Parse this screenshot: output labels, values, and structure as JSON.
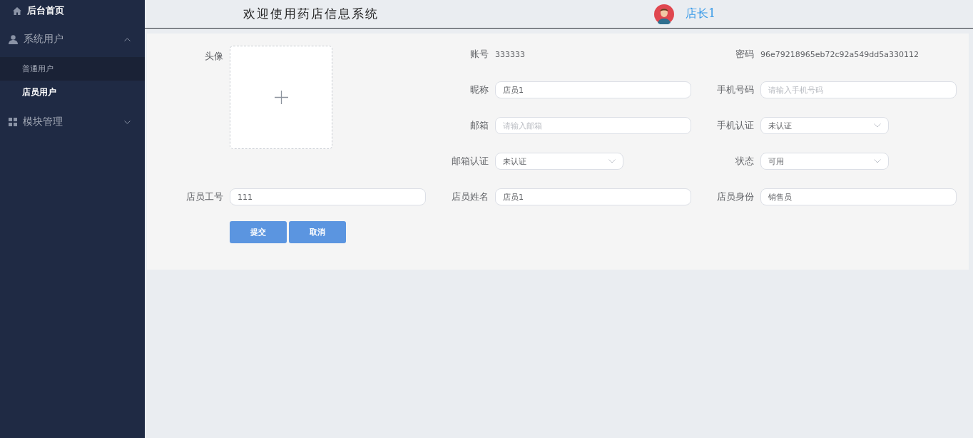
{
  "sidebar": {
    "items": [
      {
        "label": "后台首页"
      },
      {
        "label": "系统用户",
        "expanded": true,
        "children": [
          {
            "label": "普通用户",
            "selected": false,
            "hovered": true
          },
          {
            "label": "店员用户",
            "selected": true,
            "hovered": false
          }
        ]
      },
      {
        "label": "模块管理",
        "expanded": false
      }
    ]
  },
  "header": {
    "title": "欢迎使用药店信息系统",
    "user_name": "店长1"
  },
  "form": {
    "fields": [
      {
        "label": "头像",
        "kind": "upload"
      },
      {
        "label": "账号",
        "kind": "text",
        "value": "333333"
      },
      {
        "label": "密码",
        "kind": "text",
        "value": "96e79218965eb72c92a549dd5a330112"
      },
      {
        "label": "昵称",
        "kind": "input",
        "value": "店员1"
      },
      {
        "label": "手机号码",
        "kind": "input",
        "placeholder": "请输入手机号码"
      },
      {
        "label": "邮箱",
        "kind": "input",
        "placeholder": "请输入邮箱"
      },
      {
        "label": "手机认证",
        "kind": "select",
        "value": "未认证"
      },
      {
        "label": "邮箱认证",
        "kind": "select",
        "value": "未认证"
      },
      {
        "label": "状态",
        "kind": "select",
        "value": "可用"
      },
      {
        "label": "店员工号",
        "kind": "input",
        "value": "111"
      },
      {
        "label": "店员姓名",
        "kind": "input",
        "value": "店员1"
      },
      {
        "label": "店员身份",
        "kind": "input",
        "value": "销售员"
      }
    ],
    "buttons": [
      "提交",
      "取消"
    ]
  }
}
